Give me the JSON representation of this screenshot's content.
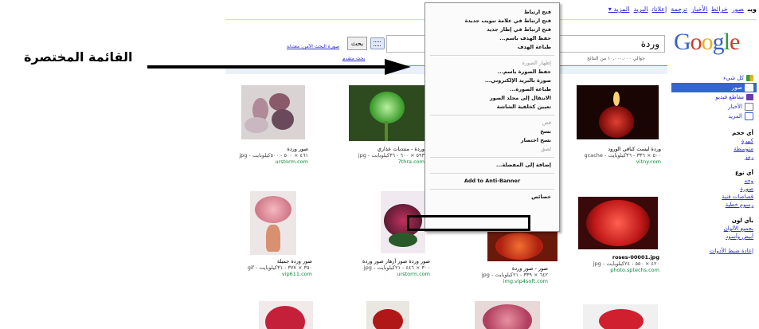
{
  "top_nav": {
    "items": [
      "ويب",
      "صور",
      "خرائط",
      "الأخبار",
      "ترجمة",
      "إعلانات",
      "البريد",
      "المزيد ▾"
    ]
  },
  "logo": {
    "letters": [
      "G",
      "o",
      "o",
      "g",
      "l",
      "e"
    ],
    "colors": [
      "#3b63c6",
      "#cf3a2d",
      "#e8b021",
      "#3b63c6",
      "#2e9b3b",
      "#cf3a2d"
    ]
  },
  "search": {
    "query": "وردة",
    "button_label": "بحث",
    "adv_link": "صورة البحث الآمن: معتدلة",
    "adv_search": "بحث متقدم",
    "result_count": "حوالي ١٠,٠٠٠,٠٠٠ من النتائج"
  },
  "sidebar": {
    "items": [
      {
        "label": "كل شيء",
        "icon": "grid-icon",
        "color": "#3a9b3a"
      },
      {
        "label": "صور",
        "icon": "image-icon",
        "color": "#ffffff"
      },
      {
        "label": "مقاطع فيديو",
        "icon": "video-icon",
        "color": "#6a3aa8"
      },
      {
        "label": "الأخبار",
        "icon": "news-icon",
        "color": "#777777"
      },
      {
        "label": "المزيد",
        "icon": "more-icon",
        "color": "#3366cc"
      }
    ],
    "size_title": "أي حجم",
    "size_links": [
      "كبيرة",
      "متوسطة",
      "رمز"
    ],
    "type_title": "أي نوع",
    "type_links": [
      "وجه",
      "صورة",
      "قصاصات فنية",
      "رسوم خطية"
    ],
    "color_title": "بأي لون",
    "color_links": [
      "بجميع الألوان",
      "أبيض وأسود"
    ],
    "reset_link": "إعادة ضبط الأدوات"
  },
  "results": [
    {
      "caption": "صور وردة",
      "meta": "٤٦١ × ٥٠٠ - ٥٠٠كيلوبايت - jpg",
      "site": "urstorm.com"
    },
    {
      "caption": "وردة - منتديات عذاري",
      "meta": "٥٩٣ × ٦٠٠ - ٣٦كيلوبايت - jpg",
      "site": "7thra.com"
    },
    {
      "caption": "",
      "meta": "",
      "site": ""
    },
    {
      "caption": "وردة ليست كباقي الورود",
      "meta": "٥٠٠ × ٣٣٦ - ٣٦كيلوبايت - gcache",
      "site": "vitny.com"
    },
    {
      "caption": "صور وردة جميلة",
      "meta": "٣٥٠ × ٣٧٧ - ٣١كيلوبايت - gif",
      "site": "vip611.com"
    },
    {
      "caption": "صور وردة صور أزهار صور وردة",
      "meta": "٣٠٠ × ٤٤٦ - ٢١كيلوبايت - jpg",
      "site": "urstorm.com"
    },
    {
      "caption": "صور - صور وردة",
      "meta": "٦٤٢ × ٣٣٩ - ٢١كيلوبايت - jpg",
      "site": "img.vip4soft.com"
    },
    {
      "caption": "roses-00001.jpg",
      "meta": "٤٢٠ × ٥٥٠ - ٢٤كيلوبايت - jpg",
      "site": "photo.sptechs.com"
    }
  ],
  "context_menu": {
    "items": [
      {
        "label": "فتح ارتباط",
        "disabled": false
      },
      {
        "label": "فتح ارتباط في علامة تبويب جديدة",
        "disabled": false
      },
      {
        "label": "فتح ارتباط في إطار جديد",
        "disabled": false
      },
      {
        "label": "حفظ الهدف باسم...",
        "disabled": false
      },
      {
        "label": "طباعة الهدف",
        "disabled": false
      },
      {
        "sep": true
      },
      {
        "label": "إظهار الصورة",
        "disabled": true
      },
      {
        "label": "حفظ الصورة باسم...",
        "disabled": false
      },
      {
        "label": "صورة بالبريد الإلكتروني...",
        "disabled": false
      },
      {
        "label": "طباعة الصورة...",
        "disabled": false
      },
      {
        "label": "الانتقال إلى مجلد الصور",
        "disabled": false
      },
      {
        "label": "تعيين كخلفية الشاشة",
        "disabled": false
      },
      {
        "sep": true
      },
      {
        "label": "قص",
        "disabled": true
      },
      {
        "label": "نسخ",
        "disabled": false
      },
      {
        "label": "نسخ اختصار",
        "disabled": false
      },
      {
        "label": "لصق",
        "disabled": true
      },
      {
        "sep": true
      },
      {
        "label": "إضافة إلى المفضلة...",
        "disabled": false
      },
      {
        "sep": true
      },
      {
        "label": "Add to Anti-Banner",
        "disabled": false,
        "ltr": true
      },
      {
        "sep": true
      },
      {
        "label": "خصائص",
        "disabled": false
      }
    ]
  },
  "annotation": {
    "label": "القائمة المختصرة"
  }
}
